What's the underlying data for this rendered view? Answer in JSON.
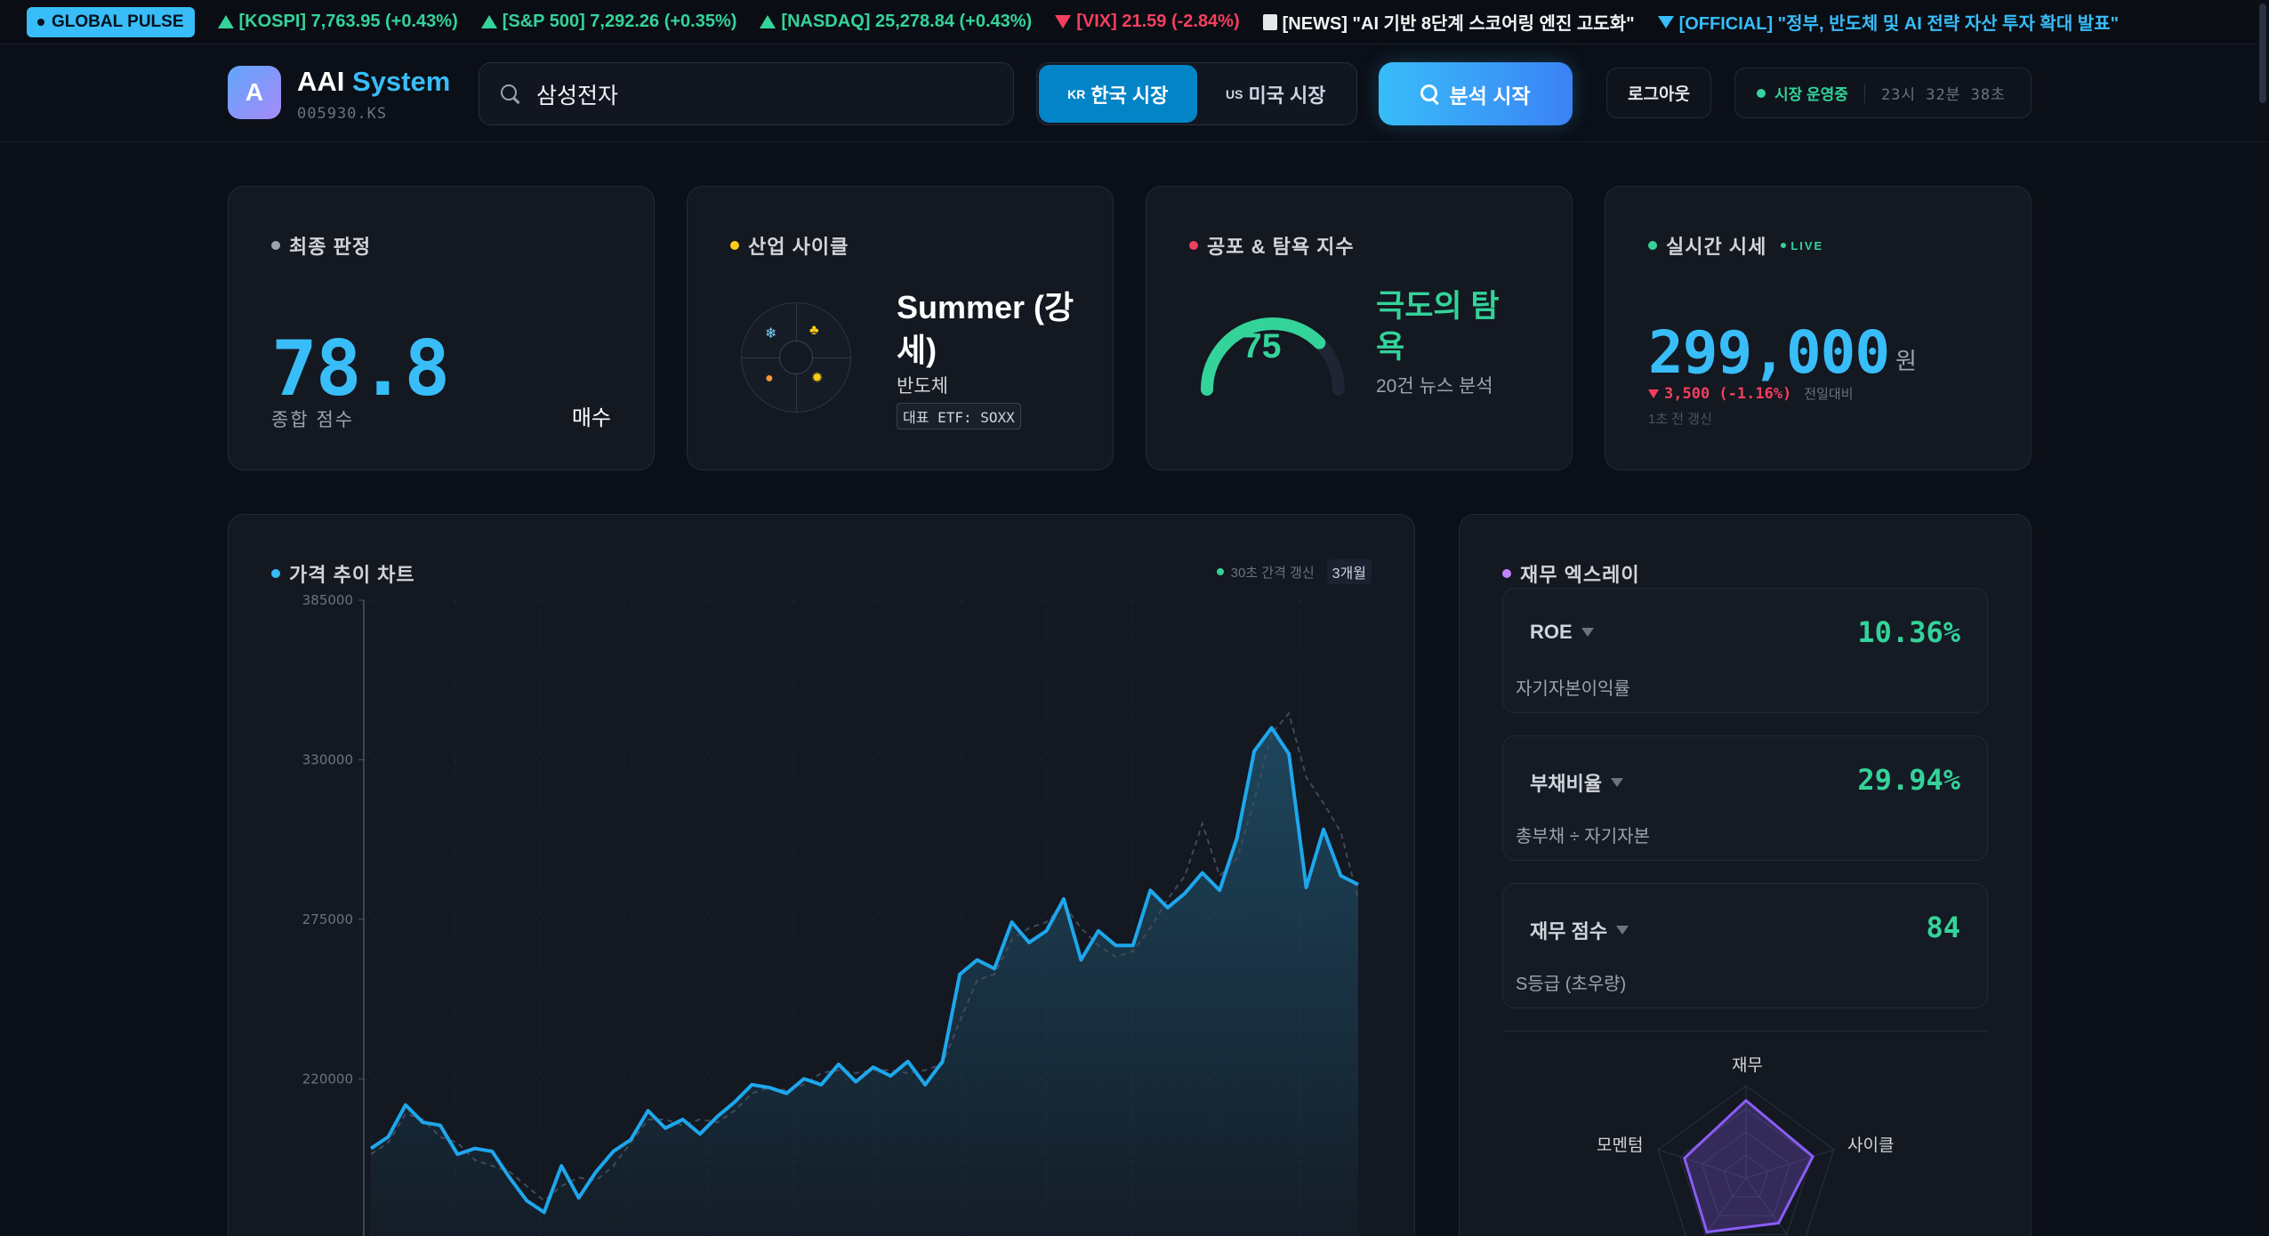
{
  "ticker": {
    "badge": "GLOBAL PULSE",
    "items": [
      {
        "dir": "up",
        "text": "[KOSPI] 7,763.95 (+0.43%)"
      },
      {
        "dir": "up",
        "text": "[S&P 500] 7,292.26 (+0.35%)"
      },
      {
        "dir": "up",
        "text": "[NASDAQ] 25,278.84 (+0.43%)"
      },
      {
        "dir": "down",
        "text": "[VIX] 21.59 (-2.84%)"
      },
      {
        "dir": "news",
        "text": "[NEWS] \"AI 기반 8단계 스코어링 엔진 고도화\""
      },
      {
        "dir": "official",
        "text": "[OFFICIAL] \"정부, 반도체 및 AI 전략 자산 투자 확대 발표\""
      }
    ]
  },
  "header": {
    "logo_letter": "A",
    "brand_1": "AAI",
    "brand_2": "System",
    "ticker_code": "005930.KS",
    "search_value": "삼성전자",
    "market_kr_code": "KR",
    "market_kr": "한국 시장",
    "market_us_code": "US",
    "market_us": "미국 시장",
    "analyze": "분석 시작",
    "logout": "로그아웃",
    "status": "시장 운영중",
    "clock": "23시 32분 38초"
  },
  "verdict_card": {
    "title": "최종 판정",
    "score": "78.8",
    "score_label": "종합 점수",
    "verdict": "매수"
  },
  "cycle_card": {
    "title": "산업 사이클",
    "name": "Summer (강세)",
    "sector": "반도체",
    "etf": "대표 ETF: SOXX",
    "icons": [
      "snowflake-icon",
      "sprout-icon",
      "leaf-icon",
      "sun-icon"
    ]
  },
  "fear_card": {
    "title": "공포 & 탐욕 지수",
    "value": 75,
    "value_text": "75",
    "label": "극도의 탐욕",
    "sub": "20건 뉴스 분석"
  },
  "price_card": {
    "title": "실시간 시세",
    "live": "LIVE",
    "price": "299,000",
    "unit": "원",
    "change": "3,500 (-1.16%)",
    "change_sub": "전일대비",
    "updated": "1초 전 갱신"
  },
  "chart_card": {
    "title": "가격 추이 차트",
    "refresh": "30초 간격 갱신",
    "period": "3개월"
  },
  "chart_data": {
    "type": "line",
    "ylim": [
      160000,
      385000
    ],
    "yticks": [
      "385000",
      "330000",
      "275000",
      "220000"
    ],
    "ytick_values": [
      385000,
      330000,
      275000,
      220000
    ],
    "series": [
      {
        "values": [
          196000,
          200000,
          211000,
          205000,
          204000,
          194000,
          196000,
          195000,
          186000,
          178000,
          174000,
          190000,
          179000,
          188000,
          195000,
          199000,
          209000,
          203000,
          206000,
          201000,
          207000,
          212000,
          218000,
          217000,
          215000,
          220000,
          218000,
          225000,
          219000,
          224000,
          221000,
          226000,
          218000,
          226000,
          256000,
          261000,
          258000,
          274000,
          267000,
          271000,
          282000,
          261000,
          271000,
          266000,
          266000,
          285000,
          279000,
          284000,
          291000,
          285000,
          303000,
          333000,
          341000,
          332000,
          286000,
          306000,
          290000,
          287000
        ]
      },
      {
        "values": [
          194000,
          198000,
          208000,
          206000,
          200000,
          198000,
          192000,
          190000,
          188000,
          183000,
          178000,
          183000,
          186000,
          185000,
          190000,
          198000,
          206000,
          206000,
          204000,
          206000,
          205000,
          209000,
          215000,
          217000,
          216000,
          218000,
          222000,
          223000,
          222000,
          223000,
          223000,
          222000,
          223000,
          225000,
          240000,
          254000,
          256000,
          268000,
          272000,
          274000,
          280000,
          272000,
          266000,
          262000,
          264000,
          272000,
          282000,
          290000,
          308000,
          290000,
          296000,
          316000,
          339000,
          346000,
          324000,
          315000,
          305000,
          282000
        ]
      }
    ]
  },
  "financial_card": {
    "title": "재무 엑스레이",
    "items": [
      {
        "name": "ROE",
        "value": "10.36%",
        "desc": "자기자본이익률"
      },
      {
        "name": "부채비율",
        "value": "29.94%",
        "desc": "총부채 ÷ 자기자본"
      },
      {
        "name": "재무 점수",
        "value": "84",
        "desc": "S등급 (초우량)"
      }
    ],
    "radar": {
      "labels": [
        "재무",
        "사이클",
        "모멘텀"
      ],
      "values": [
        0.84,
        0.76,
        0.6,
        0.72,
        0.7
      ]
    }
  },
  "colors": {
    "accent": "#38bdf8",
    "positive": "#34d399",
    "negative": "#f43f5e",
    "purple": "#a78bfa"
  }
}
